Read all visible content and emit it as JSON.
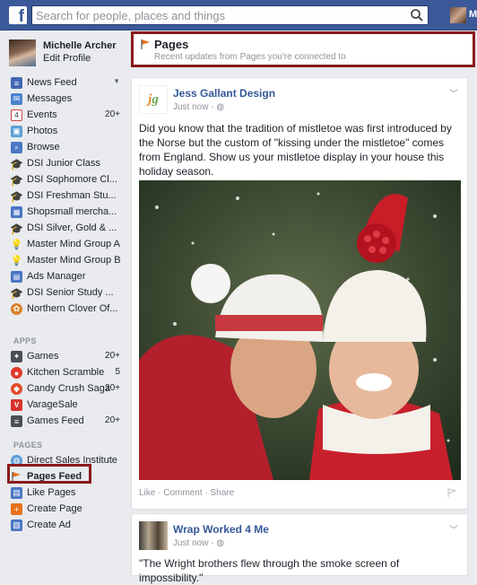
{
  "topbar": {
    "logo": "f",
    "search_placeholder": "Search for people, places and things",
    "user_short": "M"
  },
  "profile": {
    "name": "Michelle Archer",
    "edit_label": "Edit Profile"
  },
  "nav": [
    {
      "label": "News Feed",
      "icon": "news-feed-icon",
      "count": ""
    },
    {
      "label": "Messages",
      "icon": "messages-icon",
      "count": ""
    },
    {
      "label": "Events",
      "icon": "calendar-icon",
      "count": "20+"
    },
    {
      "label": "Photos",
      "icon": "photos-icon",
      "count": ""
    },
    {
      "label": "Browse",
      "icon": "browse-icon",
      "count": ""
    },
    {
      "label": "DSI Junior Class",
      "icon": "graduation-cap-icon",
      "count": ""
    },
    {
      "label": "DSI Sophomore Cl...",
      "icon": "graduation-cap-icon",
      "count": ""
    },
    {
      "label": "DSI Freshman Stu...",
      "icon": "graduation-cap-icon",
      "count": ""
    },
    {
      "label": "Shopsmall mercha...",
      "icon": "group-icon",
      "count": ""
    },
    {
      "label": "DSI Silver, Gold & ...",
      "icon": "graduation-cap-icon",
      "count": ""
    },
    {
      "label": "Master Mind Group A",
      "icon": "lightbulb-icon",
      "count": ""
    },
    {
      "label": "Master Mind Group B",
      "icon": "lightbulb-icon",
      "count": ""
    },
    {
      "label": "Ads Manager",
      "icon": "ads-manager-icon",
      "count": ""
    },
    {
      "label": "DSI Senior Study ...",
      "icon": "graduation-cap-icon",
      "count": ""
    },
    {
      "label": "Northern Clover Of...",
      "icon": "clover-icon",
      "count": ""
    }
  ],
  "apps_heading": "APPS",
  "apps": [
    {
      "label": "Games",
      "icon": "games-icon",
      "count": "20+"
    },
    {
      "label": "Kitchen Scramble",
      "icon": "kitchen-scramble-icon",
      "count": "5"
    },
    {
      "label": "Candy Crush Saga",
      "icon": "candy-crush-icon",
      "count": "20+"
    },
    {
      "label": "VarageSale",
      "icon": "varagesale-icon",
      "count": ""
    },
    {
      "label": "Games Feed",
      "icon": "games-feed-icon",
      "count": "20+"
    }
  ],
  "pages_heading": "PAGES",
  "pages": [
    {
      "label": "Direct Sales Institute",
      "icon": "globe-icon",
      "count": ""
    },
    {
      "label": "Pages Feed",
      "icon": "flag-icon",
      "count": ""
    },
    {
      "label": "Like Pages",
      "icon": "like-pages-icon",
      "count": ""
    },
    {
      "label": "Create Page",
      "icon": "create-page-icon",
      "count": ""
    },
    {
      "label": "Create Ad",
      "icon": "create-ad-icon",
      "count": ""
    }
  ],
  "header": {
    "title": "Pages",
    "subtitle": "Recent updates from Pages you're connected to"
  },
  "posts": [
    {
      "page_name": "Jess Gallant Design",
      "time": "Just now · ",
      "text": "Did you know that the tradition of mistletoe was first introduced by the Norse but the custom of \"kissing under the mistletoe\" comes from England. Show us your mistletoe display in your house this holiday season.",
      "actions": {
        "like": "Like",
        "comment": "Comment",
        "share": "Share"
      }
    },
    {
      "page_name": "Wrap Worked 4 Me",
      "time": "Just now · ",
      "text": "\"The Wright brothers flew through the smoke screen of impossibility.\""
    }
  ],
  "colors": {
    "brand_blue": "#3b5998",
    "highlight_red": "#8b1a1a",
    "link_blue": "#365899"
  }
}
